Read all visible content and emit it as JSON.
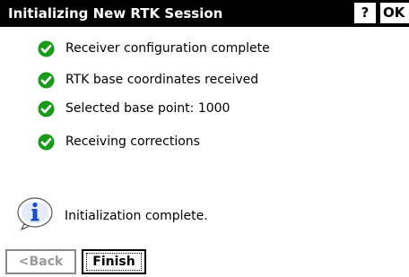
{
  "title_bar": {
    "title": "Initializing New RTK Session",
    "help_label": "?",
    "ok_label": "OK"
  },
  "status_items": [
    {
      "label": "Receiver configuration complete",
      "icon": "check-circle-icon"
    },
    {
      "label": "RTK base coordinates received",
      "icon": "check-circle-icon"
    },
    {
      "label": "Selected base point: 1000",
      "icon": "check-circle-icon"
    },
    {
      "label": "Receiving corrections",
      "icon": "check-circle-icon"
    }
  ],
  "info": {
    "message": "Initialization complete.",
    "icon": "info-icon"
  },
  "buttons": {
    "back_label": "<Back",
    "finish_label": "Finish"
  },
  "colors": {
    "title_bar_bg": "#000000",
    "check_green": "#1a9a1a",
    "info_blue": "#1e4fc2",
    "disabled_text": "#9a9a9a"
  }
}
